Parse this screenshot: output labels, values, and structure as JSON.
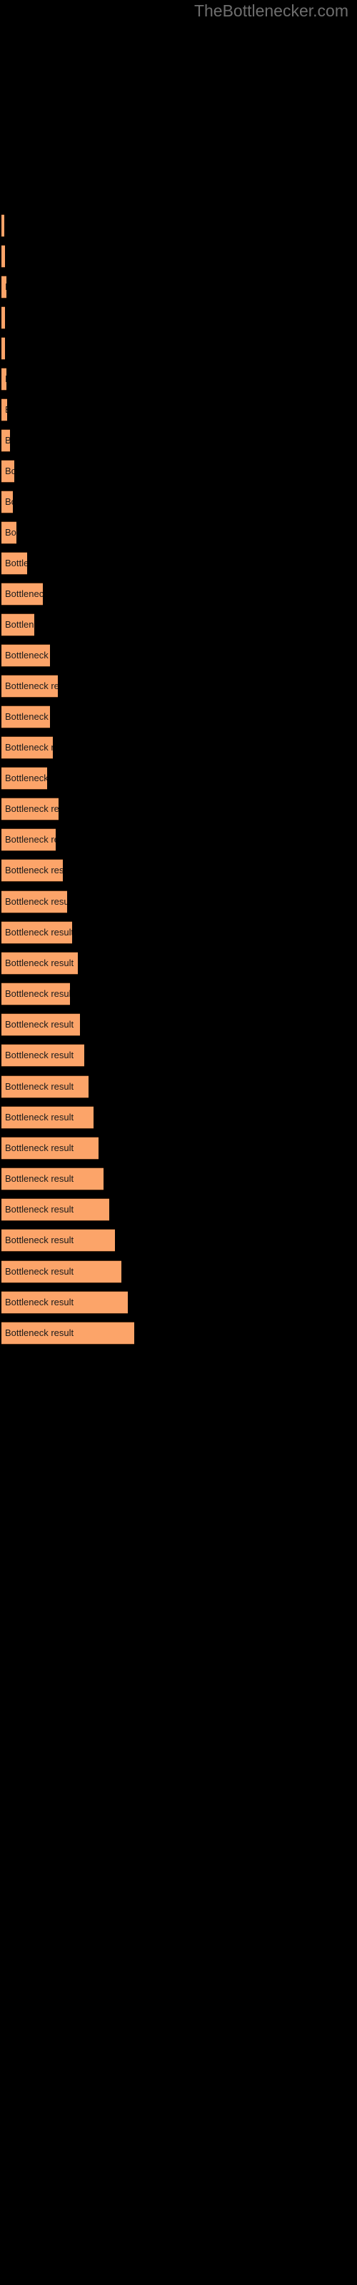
{
  "watermark": {
    "text": "TheBottlenecker.com"
  },
  "colors": {
    "background": "#000000",
    "bar_fill": "#fca469",
    "bar_edge": "#4a2a12",
    "bar_label_text": "#1a1a1a",
    "watermark_text": "#6e6e6e"
  },
  "chart_data": {
    "type": "bar",
    "orientation": "horizontal",
    "title": "",
    "subtitle": "",
    "xlabel": "",
    "ylabel": "",
    "grid": false,
    "legend": false,
    "axis_visible": false,
    "tick_labels_visible": false,
    "bar_label_text": "Bottleneck result",
    "xlim": [
      0,
      500
    ],
    "categories": [
      "",
      "",
      "",
      "",
      "",
      "",
      "",
      "",
      "",
      "",
      "",
      "",
      "",
      "",
      "",
      "",
      "",
      "",
      "",
      "",
      "",
      "",
      "",
      "",
      "",
      "",
      "",
      "",
      "",
      "",
      "",
      "",
      "",
      "",
      "",
      "",
      ""
    ],
    "values": [
      3,
      4,
      5,
      5,
      6,
      7,
      8,
      16,
      22,
      24,
      25,
      30,
      40,
      55,
      70,
      78,
      88,
      96,
      105,
      110,
      120,
      126,
      132,
      140,
      146,
      152,
      157,
      163,
      168,
      171,
      175,
      178,
      182,
      185,
      188,
      191,
      194
    ],
    "bars": [
      {
        "label": "Bottleneck result",
        "value": 3,
        "y": 155,
        "height": 32
      },
      {
        "label": "Bottleneck result",
        "value": 4,
        "y": 198,
        "height": 32
      },
      {
        "label": "Bottleneck result",
        "value": 5,
        "y": 241,
        "height": 32
      },
      {
        "label": "Bottleneck result",
        "value": 5,
        "y": 284,
        "height": 32
      },
      {
        "label": "Bottleneck result",
        "value": 6,
        "y": 327,
        "height": 32
      },
      {
        "label": "Bottleneck result",
        "value": 7,
        "y": 370,
        "height": 32
      },
      {
        "label": "Bottleneck result",
        "value": 8,
        "y": 413,
        "height": 32
      },
      {
        "label": "Bottleneck result",
        "value": 16,
        "y": 457,
        "height": 32
      },
      {
        "label": "Bottleneck result",
        "value": 22,
        "y": 500,
        "height": 32
      },
      {
        "label": "Bottleneck result",
        "value": 24,
        "y": 543,
        "height": 32
      },
      {
        "label": "Bottleneck result",
        "value": 25,
        "y": 586,
        "height": 32
      },
      {
        "label": "Bottleneck result",
        "value": 40,
        "y": 629,
        "height": 32
      },
      {
        "label": "Bottleneck result",
        "value": 62,
        "y": 672,
        "height": 32
      },
      {
        "label": "Bottleneck result",
        "value": 50,
        "y": 715,
        "height": 32
      },
      {
        "label": "Bottleneck result",
        "value": 72,
        "y": 758,
        "height": 32
      },
      {
        "label": "Bottleneck result",
        "value": 83,
        "y": 801,
        "height": 32
      },
      {
        "label": "Bottleneck result",
        "value": 72,
        "y": 845,
        "height": 32
      },
      {
        "label": "Bottleneck result",
        "value": 76,
        "y": 888,
        "height": 32
      },
      {
        "label": "Bottleneck result",
        "value": 68,
        "y": 931,
        "height": 32
      },
      {
        "label": "Bottleneck result",
        "value": 84,
        "y": 974,
        "height": 32
      },
      {
        "label": "Bottleneck result",
        "value": 80,
        "y": 1017,
        "height": 32
      },
      {
        "label": "Bottleneck result",
        "value": 90,
        "y": 1060,
        "height": 32
      },
      {
        "label": "Bottleneck result",
        "value": 96,
        "y": 1104,
        "height": 32
      },
      {
        "label": "Bottleneck result",
        "value": 103,
        "y": 1147,
        "height": 32
      },
      {
        "label": "Bottleneck result",
        "value": 110,
        "y": 1190,
        "height": 32
      },
      {
        "label": "Bottleneck result",
        "value": 100,
        "y": 1233,
        "height": 32
      },
      {
        "label": "Bottleneck result",
        "value": 114,
        "y": 1276,
        "height": 32
      },
      {
        "label": "Bottleneck result",
        "value": 120,
        "y": 1319,
        "height": 32
      },
      {
        "label": "Bottleneck result",
        "value": 126,
        "y": 1363,
        "height": 32
      },
      {
        "label": "Bottleneck result",
        "value": 133,
        "y": 1406,
        "height": 32
      },
      {
        "label": "Bottleneck result",
        "value": 140,
        "y": 1449,
        "height": 32
      },
      {
        "label": "Bottleneck result",
        "value": 147,
        "y": 1492,
        "height": 32
      },
      {
        "label": "Bottleneck result",
        "value": 155,
        "y": 1535,
        "height": 32
      },
      {
        "label": "Bottleneck result",
        "value": 163,
        "y": 1578,
        "height": 32
      },
      {
        "label": "Bottleneck result",
        "value": 172,
        "y": 1622,
        "height": 32
      },
      {
        "label": "Bottleneck result",
        "value": 181,
        "y": 1665,
        "height": 32
      },
      {
        "label": "Bottleneck result",
        "value": 190,
        "y": 1708,
        "height": 32
      }
    ]
  },
  "bar_rows": [
    {
      "label": "Bottleneck result",
      "top": 160,
      "height": 32,
      "width": 4
    },
    {
      "label": "Bottleneck result",
      "top": 203,
      "height": 32,
      "width": 5
    },
    {
      "label": "Bottleneck result",
      "top": 246,
      "height": 32,
      "width": 7
    },
    {
      "label": "Bottleneck result",
      "top": 289,
      "height": 32,
      "width": 5
    },
    {
      "label": "Bottleneck result",
      "top": 332,
      "height": 32,
      "width": 5
    },
    {
      "label": "Bottleneck result",
      "top": 375,
      "height": 32,
      "width": 7
    },
    {
      "label": "Bottleneck result",
      "top": 418,
      "height": 32,
      "width": 8
    },
    {
      "label": "Bottleneck result",
      "top": 461,
      "height": 32,
      "width": 12
    },
    {
      "label": "Bottleneck result",
      "top": 504,
      "height": 32,
      "width": 18
    },
    {
      "label": "Bottleneck result",
      "top": 547,
      "height": 32,
      "width": 16
    },
    {
      "label": "Bottleneck result",
      "top": 590,
      "height": 32,
      "width": 21
    },
    {
      "label": "Bottleneck result",
      "top": 633,
      "height": 32,
      "width": 36
    },
    {
      "label": "Bottleneck result",
      "top": 676,
      "height": 32,
      "width": 58
    },
    {
      "label": "Bottleneck result",
      "top": 719,
      "height": 32,
      "width": 46
    },
    {
      "label": "Bottleneck result",
      "top": 762,
      "height": 32,
      "width": 68
    },
    {
      "label": "Bottleneck result",
      "top": 805,
      "height": 32,
      "width": 79
    },
    {
      "label": "Bottleneck result",
      "top": 848,
      "height": 32,
      "width": 68
    },
    {
      "label": "Bottleneck result",
      "top": 891,
      "height": 32,
      "width": 72
    },
    {
      "label": "Bottleneck result",
      "top": 934,
      "height": 32,
      "width": 64
    },
    {
      "label": "Bottleneck result",
      "top": 977,
      "height": 32,
      "width": 80
    },
    {
      "label": "Bottleneck result",
      "top": 1020,
      "height": 32,
      "width": 76
    },
    {
      "label": "Bottleneck result",
      "top": 1063,
      "height": 32,
      "width": 86
    },
    {
      "label": "Bottleneck result",
      "top": 1107,
      "height": 32,
      "width": 92
    },
    {
      "label": "Bottleneck result",
      "top": 1150,
      "height": 32,
      "width": 99
    },
    {
      "label": "Bottleneck result",
      "top": 1193,
      "height": 32,
      "width": 107
    },
    {
      "label": "Bottleneck result",
      "top": 1236,
      "height": 32,
      "width": 96
    },
    {
      "label": "Bottleneck result",
      "top": 1279,
      "height": 32,
      "width": 110
    },
    {
      "label": "Bottleneck result",
      "top": 1322,
      "height": 32,
      "width": 116
    },
    {
      "label": "Bottleneck result",
      "top": 1366,
      "height": 32,
      "width": 122
    },
    {
      "label": "Bottleneck result",
      "top": 1409,
      "height": 32,
      "width": 129
    },
    {
      "label": "Bottleneck result",
      "top": 1452,
      "height": 32,
      "width": 136
    },
    {
      "label": "Bottleneck result",
      "top": 1495,
      "height": 32,
      "width": 143
    },
    {
      "label": "Bottleneck result",
      "top": 1538,
      "height": 32,
      "width": 151
    },
    {
      "label": "Bottleneck result",
      "top": 1581,
      "height": 32,
      "width": 159
    },
    {
      "label": "Bottleneck result",
      "top": 1625,
      "height": 32,
      "width": 168
    },
    {
      "label": "Bottleneck result",
      "top": 1668,
      "height": 32,
      "width": 177
    },
    {
      "label": "Bottleneck result",
      "top": 1711,
      "height": 32,
      "width": 186
    }
  ]
}
